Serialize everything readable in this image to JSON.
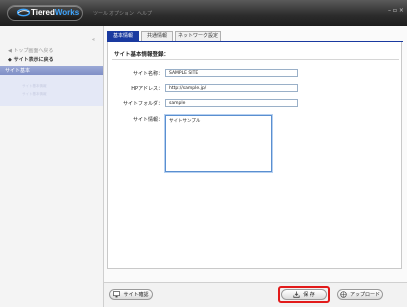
{
  "app": {
    "brand_prefix": "Tiered",
    "brand_suffix": "Works",
    "menu": [
      "ツール",
      "オプション",
      "ヘルプ"
    ],
    "window_controls": "– ▫ ×"
  },
  "sidebar": {
    "collapse_label": "«",
    "back_top": "◀ トップ画面へ戻る",
    "back_site": "◆ サイト表示に戻る",
    "section_header": "サイト基本",
    "sub_items": [
      "サイト基本情報",
      "サイト基本情報"
    ]
  },
  "tabs": [
    {
      "label": "基本情報",
      "active": true
    },
    {
      "label": "共通情報",
      "active": false
    },
    {
      "label": "ネットワーク設定",
      "active": false
    }
  ],
  "form": {
    "section_title": "サイト基本情報登録：",
    "fields": [
      {
        "label": "サイト名称：",
        "value": "SAMPLE SITE"
      },
      {
        "label": "HPアドレス：",
        "value": "http://sample.jp/"
      },
      {
        "label": "サイトフォルダ：",
        "value": "sample"
      }
    ],
    "info_label": "サイト情報：",
    "info_value": "サイトサンプル"
  },
  "footer": {
    "site_check": "サイト確認",
    "save": "保 存",
    "upload": "アップロード"
  },
  "colors": {
    "accent": "#1a3aa0",
    "highlight": "#e21b1b"
  }
}
